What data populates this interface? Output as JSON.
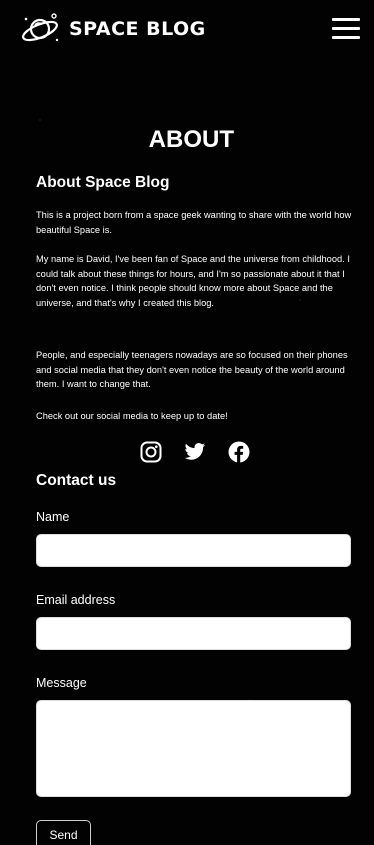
{
  "header": {
    "logo_icon": "planet-astronaut-icon",
    "title": "SPACE BLOG",
    "menu_icon": "hamburger-menu-icon"
  },
  "about": {
    "title": "ABOUT",
    "heading": "About Space Blog",
    "paragraphs": [
      "This is a project born from a space geek wanting to share with the world how beautiful Space is.",
      "My name is David, I've been fan of Space and the universe from childhood. I could talk about these things for hours, and I'm so passionate about it that I don't even notice. I think people should know more about Space and the universe, and that's why I created this blog.",
      "People, and especially teenagers nowadays are so focused on their phones and social media that they don't even notice the beauty of the world around them. I want to change that.",
      "Check out our social media to keep up to date!"
    ],
    "social": [
      {
        "icon": "instagram-icon"
      },
      {
        "icon": "twitter-icon"
      },
      {
        "icon": "facebook-icon"
      }
    ]
  },
  "contact": {
    "heading": "Contact us",
    "name_label": "Name",
    "name_value": "",
    "email_label": "Email address",
    "email_value": "",
    "message_label": "Message",
    "message_value": "",
    "send_label": "Send"
  },
  "colors": {
    "background": "#020203",
    "text": "#ffffff",
    "input_bg": "#ffffff"
  }
}
